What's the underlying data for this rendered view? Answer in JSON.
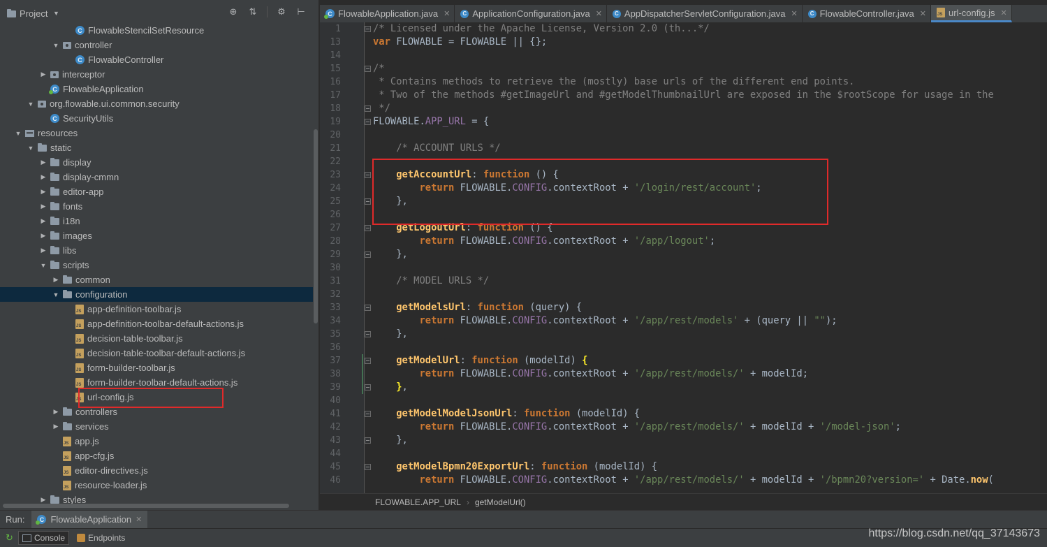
{
  "project_panel": {
    "title": "Project",
    "tree": [
      {
        "label": "FlowableStencilSetResource",
        "icon": "class-icon",
        "depth": 5,
        "arrow": "none"
      },
      {
        "label": "controller",
        "icon": "package-icon",
        "depth": 4,
        "arrow": "down"
      },
      {
        "label": "FlowableController",
        "icon": "class-icon",
        "depth": 5,
        "arrow": "none"
      },
      {
        "label": "interceptor",
        "icon": "package-icon",
        "depth": 3,
        "arrow": "right"
      },
      {
        "label": "FlowableApplication",
        "icon": "spring-app-icon",
        "depth": 3,
        "arrow": "none"
      },
      {
        "label": "org.flowable.ui.common.security",
        "icon": "package-icon",
        "depth": 2,
        "arrow": "down"
      },
      {
        "label": "SecurityUtils",
        "icon": "class-icon",
        "depth": 3,
        "arrow": "none"
      },
      {
        "label": "resources",
        "icon": "resources-folder-icon",
        "depth": 1,
        "arrow": "down"
      },
      {
        "label": "static",
        "icon": "folder-icon",
        "depth": 2,
        "arrow": "down"
      },
      {
        "label": "display",
        "icon": "folder-icon",
        "depth": 3,
        "arrow": "right"
      },
      {
        "label": "display-cmmn",
        "icon": "folder-icon",
        "depth": 3,
        "arrow": "right"
      },
      {
        "label": "editor-app",
        "icon": "folder-icon",
        "depth": 3,
        "arrow": "right"
      },
      {
        "label": "fonts",
        "icon": "folder-icon",
        "depth": 3,
        "arrow": "right"
      },
      {
        "label": "i18n",
        "icon": "folder-icon",
        "depth": 3,
        "arrow": "right"
      },
      {
        "label": "images",
        "icon": "folder-icon",
        "depth": 3,
        "arrow": "right"
      },
      {
        "label": "libs",
        "icon": "folder-icon",
        "depth": 3,
        "arrow": "right"
      },
      {
        "label": "scripts",
        "icon": "folder-icon",
        "depth": 3,
        "arrow": "down"
      },
      {
        "label": "common",
        "icon": "folder-icon",
        "depth": 4,
        "arrow": "right"
      },
      {
        "label": "configuration",
        "icon": "folder-icon",
        "depth": 4,
        "arrow": "down",
        "selected": true
      },
      {
        "label": "app-definition-toolbar.js",
        "icon": "js-file-icon",
        "depth": 5,
        "arrow": "none"
      },
      {
        "label": "app-definition-toolbar-default-actions.js",
        "icon": "js-file-icon",
        "depth": 5,
        "arrow": "none"
      },
      {
        "label": "decision-table-toolbar.js",
        "icon": "js-file-icon",
        "depth": 5,
        "arrow": "none"
      },
      {
        "label": "decision-table-toolbar-default-actions.js",
        "icon": "js-file-icon",
        "depth": 5,
        "arrow": "none"
      },
      {
        "label": "form-builder-toolbar.js",
        "icon": "js-file-icon",
        "depth": 5,
        "arrow": "none"
      },
      {
        "label": "form-builder-toolbar-default-actions.js",
        "icon": "js-file-icon",
        "depth": 5,
        "arrow": "none"
      },
      {
        "label": "url-config.js",
        "icon": "js-file-icon",
        "depth": 5,
        "arrow": "none"
      },
      {
        "label": "controllers",
        "icon": "folder-icon",
        "depth": 4,
        "arrow": "right"
      },
      {
        "label": "services",
        "icon": "folder-icon",
        "depth": 4,
        "arrow": "right"
      },
      {
        "label": "app.js",
        "icon": "js-file-icon",
        "depth": 4,
        "arrow": "none"
      },
      {
        "label": "app-cfg.js",
        "icon": "js-file-icon",
        "depth": 4,
        "arrow": "none"
      },
      {
        "label": "editor-directives.js",
        "icon": "js-file-icon",
        "depth": 4,
        "arrow": "none"
      },
      {
        "label": "resource-loader.js",
        "icon": "js-file-icon",
        "depth": 4,
        "arrow": "none"
      },
      {
        "label": "styles",
        "icon": "folder-icon",
        "depth": 3,
        "arrow": "right"
      }
    ]
  },
  "editor_tabs": [
    {
      "label": "FlowableApplication.java",
      "icon": "spring-app-icon",
      "active": false
    },
    {
      "label": "ApplicationConfiguration.java",
      "icon": "class-icon",
      "active": false
    },
    {
      "label": "AppDispatcherServletConfiguration.java",
      "icon": "class-icon",
      "active": false
    },
    {
      "label": "FlowableController.java",
      "icon": "class-icon",
      "active": false
    },
    {
      "label": "url-config.js",
      "icon": "js-file-icon",
      "active": true
    }
  ],
  "code": [
    {
      "n": "1",
      "fold": true,
      "tokens": [
        [
          "c-com",
          "/* Licensed under the Apache License, Version 2.0 (th...*/"
        ]
      ]
    },
    {
      "n": "13",
      "tokens": [
        [
          "c-kw",
          "var "
        ],
        [
          "c-plain",
          "FLOWABLE = FLOWABLE || {};"
        ]
      ]
    },
    {
      "n": "14",
      "tokens": []
    },
    {
      "n": "15",
      "fold": true,
      "tokens": [
        [
          "c-com",
          "/*"
        ]
      ]
    },
    {
      "n": "16",
      "tokens": [
        [
          "c-com",
          " * Contains methods to retrieve the (mostly) base urls of the different end points."
        ]
      ]
    },
    {
      "n": "17",
      "tokens": [
        [
          "c-com",
          " * Two of the methods #getImageUrl and #getModelThumbnailUrl are exposed in the $rootScope for usage in the"
        ]
      ]
    },
    {
      "n": "18",
      "fold": true,
      "tokens": [
        [
          "c-com",
          " */"
        ]
      ]
    },
    {
      "n": "19",
      "fold": true,
      "tokens": [
        [
          "c-plain",
          "FLOWABLE."
        ],
        [
          "c-prop",
          "APP_URL"
        ],
        [
          "c-plain",
          " = {"
        ]
      ]
    },
    {
      "n": "20",
      "tokens": []
    },
    {
      "n": "21",
      "tokens": [
        [
          "c-com",
          "    /* ACCOUNT URLS */"
        ]
      ]
    },
    {
      "n": "22",
      "tokens": []
    },
    {
      "n": "23",
      "fold": true,
      "tokens": [
        [
          "c-fn",
          "    getAccountUrl"
        ],
        [
          "c-plain",
          ": "
        ],
        [
          "c-kw",
          "function"
        ],
        [
          "c-plain",
          " () {"
        ]
      ]
    },
    {
      "n": "24",
      "tokens": [
        [
          "c-kw",
          "        return "
        ],
        [
          "c-plain",
          "FLOWABLE."
        ],
        [
          "c-prop",
          "CONFIG"
        ],
        [
          "c-plain",
          ".contextRoot + "
        ],
        [
          "c-str",
          "'/login/rest/account'"
        ],
        [
          "c-plain",
          ";"
        ]
      ]
    },
    {
      "n": "25",
      "fold": true,
      "tokens": [
        [
          "c-plain",
          "    },"
        ]
      ]
    },
    {
      "n": "26",
      "tokens": []
    },
    {
      "n": "27",
      "fold": true,
      "tokens": [
        [
          "c-fn",
          "    getLogoutUrl"
        ],
        [
          "c-plain",
          ": "
        ],
        [
          "c-kw",
          "function"
        ],
        [
          "c-plain",
          " () {"
        ]
      ]
    },
    {
      "n": "28",
      "tokens": [
        [
          "c-kw",
          "        return "
        ],
        [
          "c-plain",
          "FLOWABLE."
        ],
        [
          "c-prop",
          "CONFIG"
        ],
        [
          "c-plain",
          ".contextRoot + "
        ],
        [
          "c-str",
          "'/app/logout'"
        ],
        [
          "c-plain",
          ";"
        ]
      ]
    },
    {
      "n": "29",
      "fold": true,
      "tokens": [
        [
          "c-plain",
          "    },"
        ]
      ]
    },
    {
      "n": "30",
      "tokens": []
    },
    {
      "n": "31",
      "tokens": [
        [
          "c-com",
          "    /* MODEL URLS */"
        ]
      ]
    },
    {
      "n": "32",
      "tokens": []
    },
    {
      "n": "33",
      "fold": true,
      "tokens": [
        [
          "c-fn",
          "    getModelsUrl"
        ],
        [
          "c-plain",
          ": "
        ],
        [
          "c-kw",
          "function"
        ],
        [
          "c-plain",
          " (query) {"
        ]
      ]
    },
    {
      "n": "34",
      "tokens": [
        [
          "c-kw",
          "        return "
        ],
        [
          "c-plain",
          "FLOWABLE."
        ],
        [
          "c-prop",
          "CONFIG"
        ],
        [
          "c-plain",
          ".contextRoot + "
        ],
        [
          "c-str",
          "'/app/rest/models'"
        ],
        [
          "c-plain",
          " + (query || "
        ],
        [
          "c-str",
          "\"\""
        ],
        [
          "c-plain",
          ");"
        ]
      ]
    },
    {
      "n": "35",
      "fold": true,
      "tokens": [
        [
          "c-plain",
          "    },"
        ]
      ]
    },
    {
      "n": "36",
      "tokens": []
    },
    {
      "n": "37",
      "fold": true,
      "tokens": [
        [
          "c-fn",
          "    getModelUrl"
        ],
        [
          "c-plain",
          ": "
        ],
        [
          "c-kw",
          "function"
        ],
        [
          "c-plain",
          " (modelId) "
        ],
        [
          "c-brace-hl",
          "{"
        ]
      ]
    },
    {
      "n": "38",
      "tokens": [
        [
          "c-kw",
          "        return "
        ],
        [
          "c-plain",
          "FLOWABLE."
        ],
        [
          "c-prop",
          "CONFIG"
        ],
        [
          "c-plain",
          ".contextRoot + "
        ],
        [
          "c-str",
          "'/app/rest/models/'"
        ],
        [
          "c-plain",
          " + modelId;"
        ]
      ]
    },
    {
      "n": "39",
      "fold": true,
      "tokens": [
        [
          "c-brace-hl",
          "    }"
        ],
        [
          "c-plain",
          ","
        ]
      ]
    },
    {
      "n": "40",
      "tokens": []
    },
    {
      "n": "41",
      "fold": true,
      "tokens": [
        [
          "c-fn",
          "    getModelModelJsonUrl"
        ],
        [
          "c-plain",
          ": "
        ],
        [
          "c-kw",
          "function"
        ],
        [
          "c-plain",
          " (modelId) {"
        ]
      ]
    },
    {
      "n": "42",
      "tokens": [
        [
          "c-kw",
          "        return "
        ],
        [
          "c-plain",
          "FLOWABLE."
        ],
        [
          "c-prop",
          "CONFIG"
        ],
        [
          "c-plain",
          ".contextRoot + "
        ],
        [
          "c-str",
          "'/app/rest/models/'"
        ],
        [
          "c-plain",
          " + modelId + "
        ],
        [
          "c-str",
          "'/model-json'"
        ],
        [
          "c-plain",
          ";"
        ]
      ]
    },
    {
      "n": "43",
      "fold": true,
      "tokens": [
        [
          "c-plain",
          "    },"
        ]
      ]
    },
    {
      "n": "44",
      "tokens": []
    },
    {
      "n": "45",
      "fold": true,
      "tokens": [
        [
          "c-fn",
          "    getModelBpmn20ExportUrl"
        ],
        [
          "c-plain",
          ": "
        ],
        [
          "c-kw",
          "function"
        ],
        [
          "c-plain",
          " (modelId) {"
        ]
      ]
    },
    {
      "n": "46",
      "tokens": [
        [
          "c-kw",
          "        return "
        ],
        [
          "c-plain",
          "FLOWABLE."
        ],
        [
          "c-prop",
          "CONFIG"
        ],
        [
          "c-plain",
          ".contextRoot + "
        ],
        [
          "c-str",
          "'/app/rest/models/'"
        ],
        [
          "c-plain",
          " + modelId + "
        ],
        [
          "c-str",
          "'/bpmn20?version='"
        ],
        [
          "c-plain",
          " + Date."
        ],
        [
          "c-fn",
          "now"
        ],
        [
          "c-plain",
          "("
        ]
      ]
    }
  ],
  "breadcrumb": {
    "first": "FLOWABLE.APP_URL",
    "second": "getModelUrl()"
  },
  "run_bar": {
    "label": "Run:",
    "config_name": "FlowableApplication"
  },
  "bottom_bar": {
    "console": "Console",
    "endpoints": "Endpoints"
  },
  "watermark": "https://blog.csdn.net/qq_37143673"
}
